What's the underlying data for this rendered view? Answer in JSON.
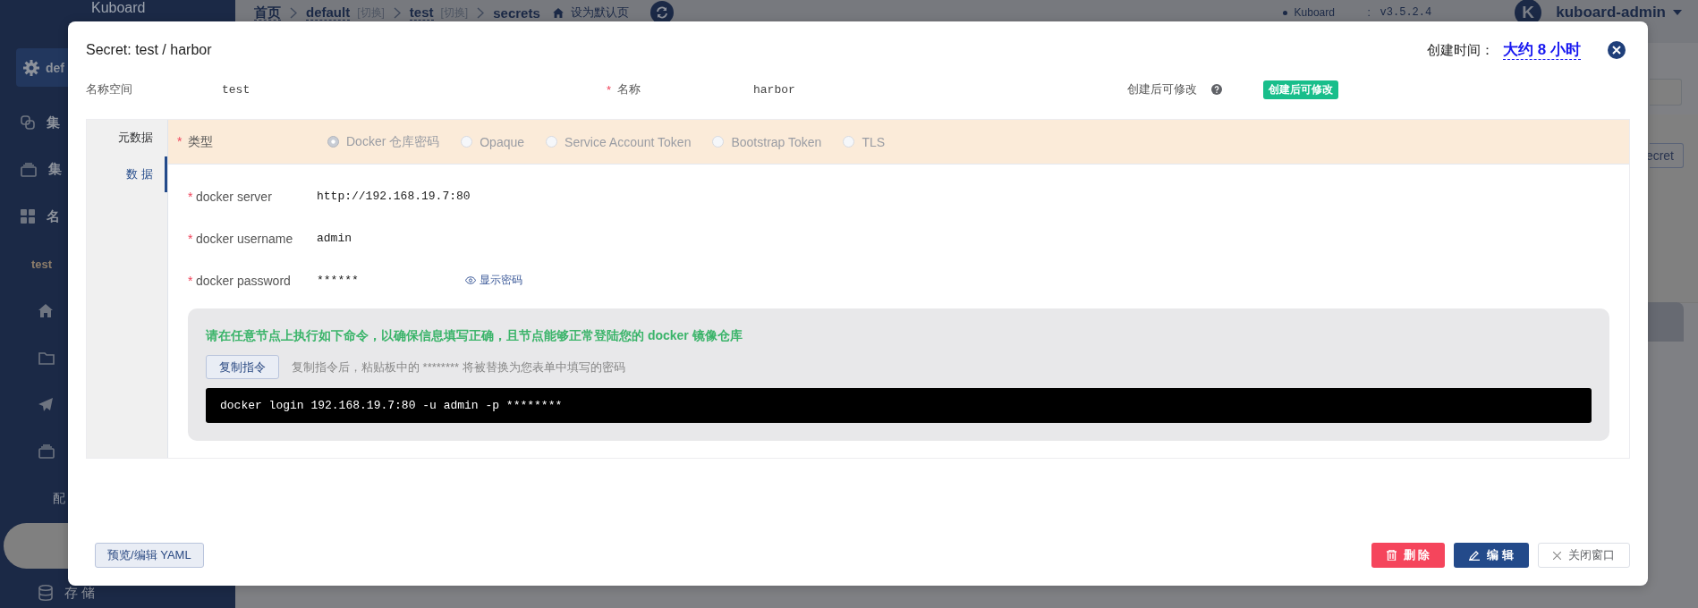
{
  "sidebar": {
    "brand": "Kuboard",
    "cluster": "def",
    "items": [
      {
        "kind": "link",
        "label": "集",
        "selected": false
      },
      {
        "kind": "stack",
        "label": "集",
        "selected": false
      },
      {
        "kind": "grid",
        "label": "名",
        "selected": false
      },
      {
        "kind": "namespace",
        "label": "test",
        "selected": false
      },
      {
        "kind": "home",
        "selected": false
      },
      {
        "kind": "folder",
        "selected": false
      },
      {
        "kind": "plane",
        "selected": false
      },
      {
        "kind": "stack-sub",
        "selected": false
      },
      {
        "kind": "group",
        "label": "配",
        "selected": false
      },
      {
        "kind": "page",
        "selected": true
      },
      {
        "kind": "db",
        "label": "存 储",
        "selected": false
      }
    ]
  },
  "breadcrumb": {
    "items": [
      {
        "label": "首页"
      },
      {
        "label": "default",
        "switch": "[切换]"
      },
      {
        "label": "test",
        "switch": "[切换]"
      },
      {
        "label": "secrets"
      }
    ],
    "set_default": "设为默认页"
  },
  "version": {
    "name": "Kuboard",
    "separator": ":",
    "value": "v3.5.2.4"
  },
  "user": {
    "avatar": "K",
    "name": "kuboard-admin"
  },
  "background": {
    "button": "ecret"
  },
  "dialog": {
    "title": "Secret: test / harbor",
    "created_label": "创建时间：",
    "created_value": "大约 8 小时",
    "meta": [
      {
        "kind": "text",
        "label": "名称空间",
        "value": "test",
        "help": false
      },
      {
        "kind": "text",
        "mark": "*",
        "label": "名称",
        "value": "harbor",
        "help": false
      },
      {
        "kind": "tag",
        "label": "创建后可修改",
        "value": "创建后可修改",
        "help": true
      }
    ],
    "tabs": [
      {
        "label": "元数据",
        "selected": false
      },
      {
        "label": "数 据",
        "selected": true
      }
    ],
    "type": {
      "mark": "*",
      "label": "类型",
      "disabled": true,
      "options": [
        {
          "label": "Docker 仓库密码",
          "selected": true
        },
        {
          "label": "Opaque",
          "selected": false
        },
        {
          "label": "Service Account Token",
          "selected": false
        },
        {
          "label": "Bootstrap Token",
          "selected": false
        },
        {
          "label": "TLS",
          "selected": false
        }
      ]
    },
    "fields": [
      {
        "mark": "*",
        "label": "docker server",
        "value": "http://192.168.19.7:80"
      },
      {
        "mark": "*",
        "label": "docker username",
        "value": "admin"
      },
      {
        "mark": "*",
        "label": "docker password",
        "value": "******",
        "action": "显示密码"
      }
    ],
    "command": {
      "title": "请在任意节点上执行如下命令，以确保信息填写正确，且节点能够正常登陆您的 docker 镜像仓库",
      "copy_button": "复制指令",
      "hint": "复制指令后，粘贴板中的 ******** 将被替换为您表单中填写的密码",
      "code": "docker login 192.168.19.7:80 -u admin -p ********"
    },
    "footer": {
      "yaml_button": "预览/编辑 YAML",
      "delete_button": "删 除",
      "edit_button": "编 辑",
      "close_button": "关闭窗口"
    }
  }
}
